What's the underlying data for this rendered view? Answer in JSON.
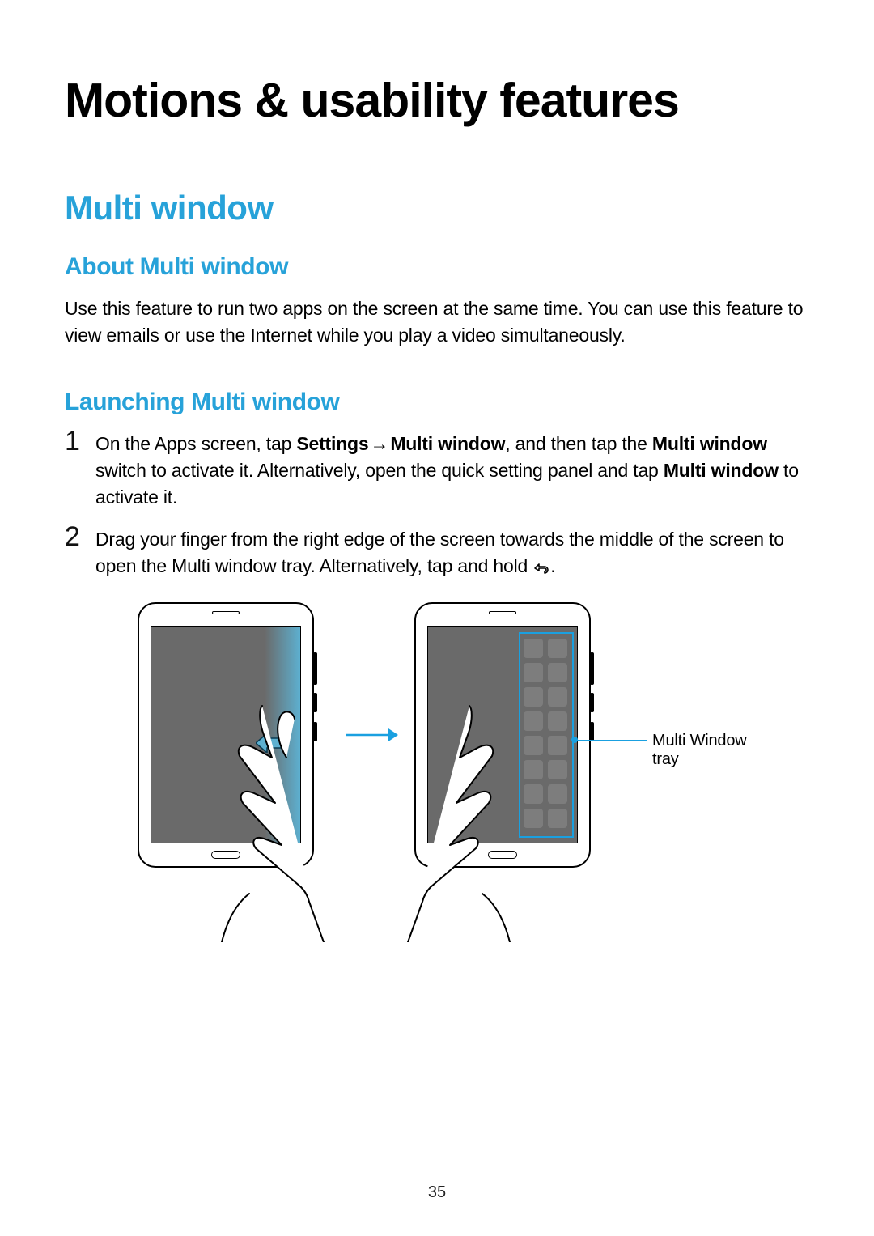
{
  "page": {
    "title": "Motions & usability features",
    "number": "35"
  },
  "section": {
    "title": "Multi window"
  },
  "about": {
    "heading": "About Multi window",
    "body": "Use this feature to run two apps on the screen at the same time. You can use this feature to view emails or use the Internet while you play a video simultaneously."
  },
  "launching": {
    "heading": "Launching Multi window",
    "steps": [
      {
        "num": "1",
        "pre1": "On the Apps screen, tap ",
        "b1": "Settings",
        "arrow": " → ",
        "b2": "Multi window",
        "mid": ", and then tap the ",
        "b3": "Multi window",
        "post": " switch to activate it. Alternatively, open the quick setting panel and tap ",
        "b4": "Multi window",
        "tail": " to activate it."
      },
      {
        "num": "2",
        "text": "Drag your finger from the right edge of the screen towards the middle of the screen to open the Multi window tray. Alternatively, tap and hold ",
        "icon_name": "back-icon",
        "tail": "."
      }
    ]
  },
  "illustration": {
    "callout": "Multi Window tray",
    "icons": {
      "swipe_left": "swipe-left-arrow-icon",
      "transition": "right-arrow-icon"
    }
  }
}
